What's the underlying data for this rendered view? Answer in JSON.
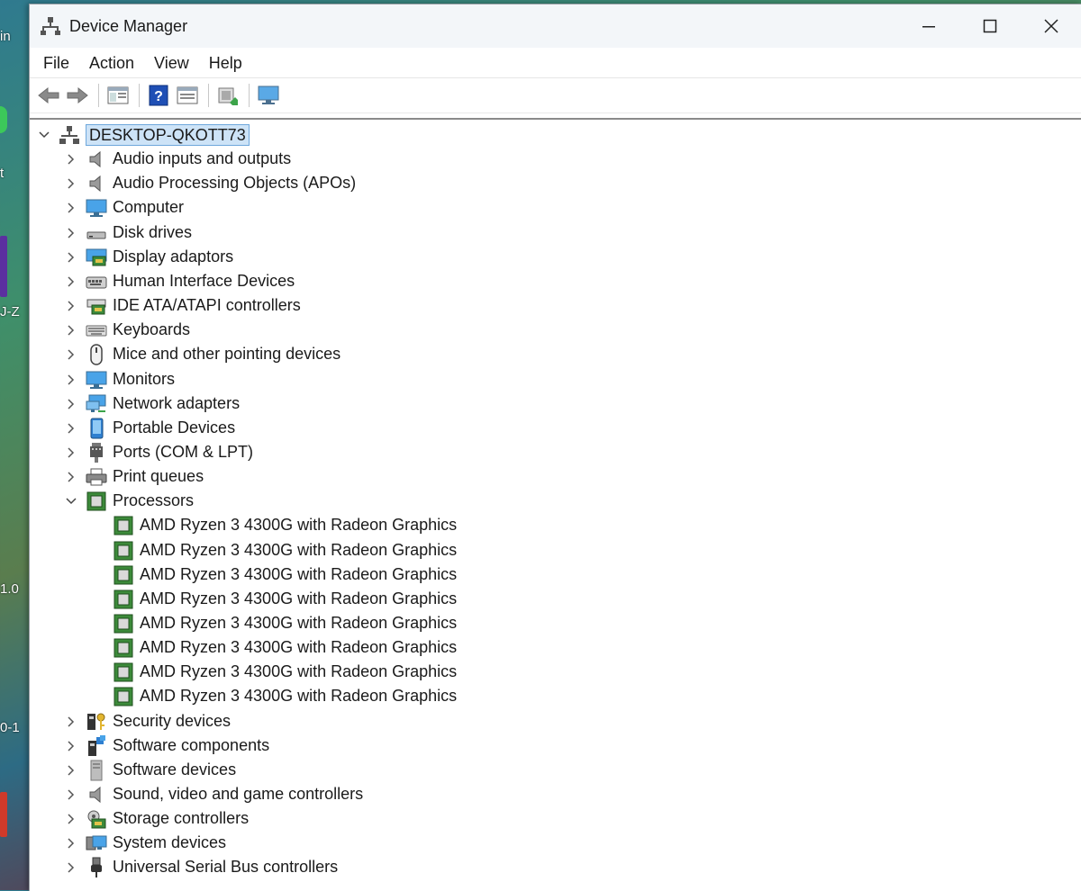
{
  "window": {
    "title": "Device Manager"
  },
  "menu": [
    "File",
    "Action",
    "View",
    "Help"
  ],
  "tree": {
    "root": "DESKTOP-QKOTT73",
    "categories": [
      {
        "label": "Audio inputs and outputs",
        "icon": "speaker-icon"
      },
      {
        "label": "Audio Processing Objects (APOs)",
        "icon": "speaker-icon"
      },
      {
        "label": "Computer",
        "icon": "monitor-icon"
      },
      {
        "label": "Disk drives",
        "icon": "disk-drive-icon"
      },
      {
        "label": "Display adaptors",
        "icon": "display-adapter-icon"
      },
      {
        "label": "Human Interface Devices",
        "icon": "hid-icon"
      },
      {
        "label": "IDE ATA/ATAPI controllers",
        "icon": "ide-controller-icon"
      },
      {
        "label": "Keyboards",
        "icon": "keyboard-icon"
      },
      {
        "label": "Mice and other pointing devices",
        "icon": "mouse-icon"
      },
      {
        "label": "Monitors",
        "icon": "monitor-icon"
      },
      {
        "label": "Network adapters",
        "icon": "network-icon"
      },
      {
        "label": "Portable Devices",
        "icon": "portable-device-icon"
      },
      {
        "label": "Ports (COM & LPT)",
        "icon": "port-icon"
      },
      {
        "label": "Print queues",
        "icon": "printer-icon"
      },
      {
        "label": "Processors",
        "icon": "processor-icon",
        "expanded": true
      },
      {
        "label": "Security devices",
        "icon": "security-device-icon"
      },
      {
        "label": "Software components",
        "icon": "software-component-icon"
      },
      {
        "label": "Software devices",
        "icon": "software-device-icon"
      },
      {
        "label": "Sound, video and game controllers",
        "icon": "speaker-icon"
      },
      {
        "label": "Storage controllers",
        "icon": "storage-controller-icon"
      },
      {
        "label": "System devices",
        "icon": "system-devices-icon"
      },
      {
        "label": "Universal Serial Bus controllers",
        "icon": "usb-icon"
      }
    ],
    "processors": [
      "AMD Ryzen 3 4300G with Radeon Graphics",
      "AMD Ryzen 3 4300G with Radeon Graphics",
      "AMD Ryzen 3 4300G with Radeon Graphics",
      "AMD Ryzen 3 4300G with Radeon Graphics",
      "AMD Ryzen 3 4300G with Radeon Graphics",
      "AMD Ryzen 3 4300G with Radeon Graphics",
      "AMD Ryzen 3 4300G with Radeon Graphics",
      "AMD Ryzen 3 4300G with Radeon Graphics"
    ]
  },
  "desktop": {
    "fragments": [
      "in",
      "t",
      "J-Z",
      "1.0",
      "0-1"
    ]
  }
}
